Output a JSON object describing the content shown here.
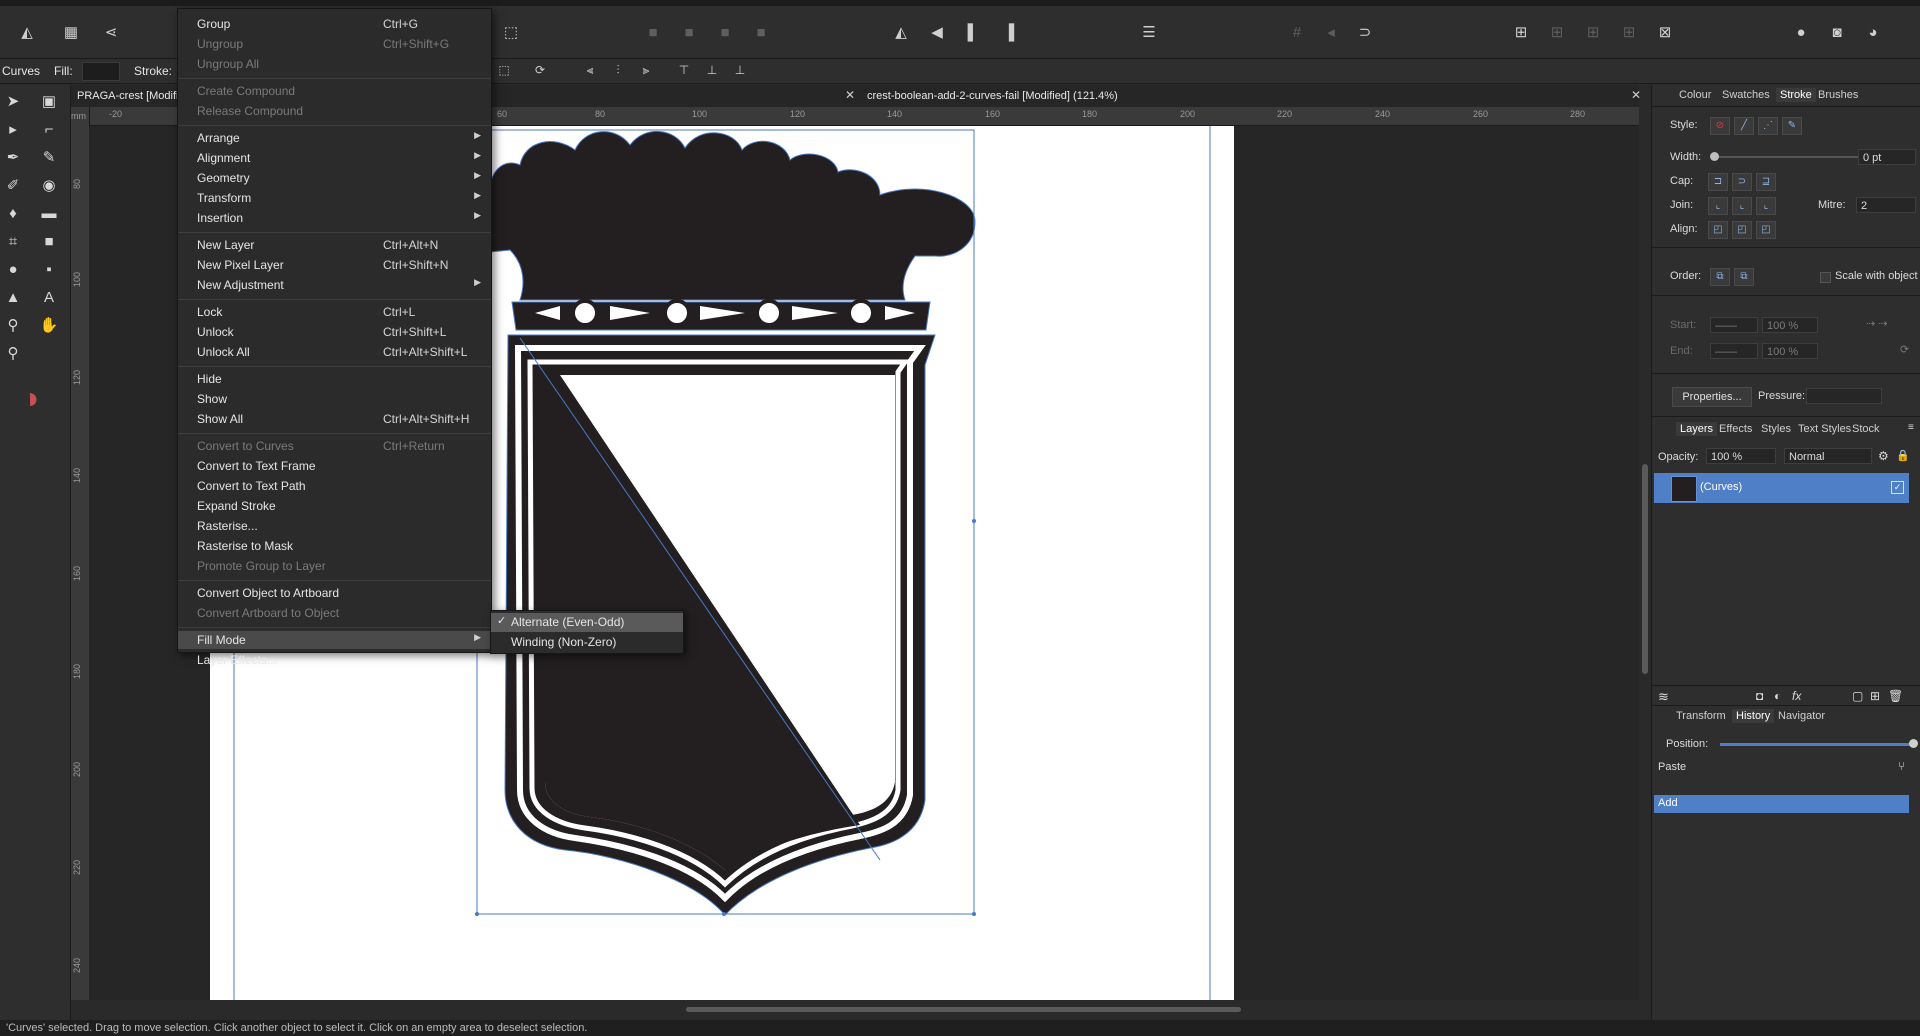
{
  "context_bar": {
    "tool_name": "Curves",
    "fill_label": "Fill:",
    "stroke_label": "Stroke:"
  },
  "tabs": [
    {
      "title": "PRAGA-crest [Modifi"
    },
    {
      "title": "crest-boolean-add-2-curves-fail [Modified] (121.4%)"
    }
  ],
  "ruler": {
    "top_ticks": [
      "-20",
      "60",
      "80",
      "100",
      "120",
      "140",
      "160",
      "180",
      "200",
      "220",
      "240",
      "260",
      "280"
    ],
    "left_ticks": [
      "mm",
      "80",
      "100",
      "120",
      "140",
      "160",
      "180",
      "200",
      "220",
      "240"
    ]
  },
  "menu": {
    "items": [
      {
        "label": "Group",
        "shortcut": "Ctrl+G",
        "disabled": false,
        "submenu": false
      },
      {
        "label": "Ungroup",
        "shortcut": "Ctrl+Shift+G",
        "disabled": true,
        "submenu": false
      },
      {
        "label": "Ungroup All",
        "shortcut": "",
        "disabled": true,
        "submenu": false
      },
      {
        "sep": true
      },
      {
        "label": "Create Compound",
        "shortcut": "",
        "disabled": true,
        "submenu": false
      },
      {
        "label": "Release Compound",
        "shortcut": "",
        "disabled": true,
        "submenu": false
      },
      {
        "sep": true
      },
      {
        "label": "Arrange",
        "shortcut": "",
        "disabled": false,
        "submenu": true
      },
      {
        "label": "Alignment",
        "shortcut": "",
        "disabled": false,
        "submenu": true
      },
      {
        "label": "Geometry",
        "shortcut": "",
        "disabled": false,
        "submenu": true
      },
      {
        "label": "Transform",
        "shortcut": "",
        "disabled": false,
        "submenu": true
      },
      {
        "label": "Insertion",
        "shortcut": "",
        "disabled": false,
        "submenu": true
      },
      {
        "sep": true
      },
      {
        "label": "New Layer",
        "shortcut": "Ctrl+Alt+N",
        "disabled": false,
        "submenu": false
      },
      {
        "label": "New Pixel Layer",
        "shortcut": "Ctrl+Shift+N",
        "disabled": false,
        "submenu": false
      },
      {
        "label": "New Adjustment",
        "shortcut": "",
        "disabled": false,
        "submenu": true
      },
      {
        "sep": true
      },
      {
        "label": "Lock",
        "shortcut": "Ctrl+L",
        "disabled": false,
        "submenu": false
      },
      {
        "label": "Unlock",
        "shortcut": "Ctrl+Shift+L",
        "disabled": false,
        "submenu": false
      },
      {
        "label": "Unlock All",
        "shortcut": "Ctrl+Alt+Shift+L",
        "disabled": false,
        "submenu": false
      },
      {
        "sep": true
      },
      {
        "label": "Hide",
        "shortcut": "",
        "disabled": false,
        "submenu": false
      },
      {
        "label": "Show",
        "shortcut": "",
        "disabled": false,
        "submenu": false
      },
      {
        "label": "Show All",
        "shortcut": "Ctrl+Alt+Shift+H",
        "disabled": false,
        "submenu": false
      },
      {
        "sep": true
      },
      {
        "label": "Convert to Curves",
        "shortcut": "Ctrl+Return",
        "disabled": true,
        "submenu": false
      },
      {
        "label": "Convert to Text Frame",
        "shortcut": "",
        "disabled": false,
        "submenu": false
      },
      {
        "label": "Convert to Text Path",
        "shortcut": "",
        "disabled": false,
        "submenu": false
      },
      {
        "label": "Expand Stroke",
        "shortcut": "",
        "disabled": false,
        "submenu": false
      },
      {
        "label": "Rasterise...",
        "shortcut": "",
        "disabled": false,
        "submenu": false
      },
      {
        "label": "Rasterise to Mask",
        "shortcut": "",
        "disabled": false,
        "submenu": false
      },
      {
        "label": "Promote Group to Layer",
        "shortcut": "",
        "disabled": true,
        "submenu": false
      },
      {
        "sep": true
      },
      {
        "label": "Convert Object to Artboard",
        "shortcut": "",
        "disabled": false,
        "submenu": false
      },
      {
        "label": "Convert Artboard to Object",
        "shortcut": "",
        "disabled": true,
        "submenu": false
      },
      {
        "sep": true
      },
      {
        "label": "Fill Mode",
        "shortcut": "",
        "disabled": false,
        "submenu": true,
        "highlighted": true
      },
      {
        "label": "Layer Effects...",
        "shortcut": "",
        "disabled": false,
        "submenu": false
      }
    ]
  },
  "submenu": {
    "items": [
      {
        "label": "Alternate (Even-Odd)",
        "checked": true
      },
      {
        "label": "Winding (Non-Zero)",
        "checked": false
      }
    ]
  },
  "stroke_panel": {
    "tabs": [
      "Colour",
      "Swatches",
      "Stroke",
      "Brushes"
    ],
    "active_tab": "Stroke",
    "style_label": "Style:",
    "width_label": "Width:",
    "width_value": "0 pt",
    "cap_label": "Cap:",
    "join_label": "Join:",
    "mitre_label": "Mitre:",
    "mitre_value": "2",
    "align_label": "Align:",
    "order_label": "Order:",
    "scale_label": "Scale with object",
    "start_label": "Start:",
    "end_label": "End:",
    "start_pct": "100 %",
    "end_pct": "100 %",
    "properties_button": "Properties...",
    "pressure_label": "Pressure:"
  },
  "layers_panel": {
    "tabs": [
      "Layers",
      "Effects",
      "Styles",
      "Text Styles",
      "Stock"
    ],
    "active_tab": "Layers",
    "opacity_label": "Opacity:",
    "opacity_value": "100 %",
    "blend_mode": "Normal",
    "layer_name": "(Curves)"
  },
  "history_panel": {
    "tabs": [
      "Transform",
      "History",
      "Navigator"
    ],
    "active_tab": "History",
    "position_label": "Position:",
    "entries": [
      "Paste",
      "Add"
    ]
  },
  "status": {
    "text": "'Curves' selected. Drag to move selection. Click another object to select it. Click on an empty area to deselect selection."
  },
  "colors": {
    "accent": "#4f7fc7",
    "menu_bg": "#2b2b2b",
    "crest_fill": "#231f20",
    "selection_line": "#4a78c4"
  }
}
